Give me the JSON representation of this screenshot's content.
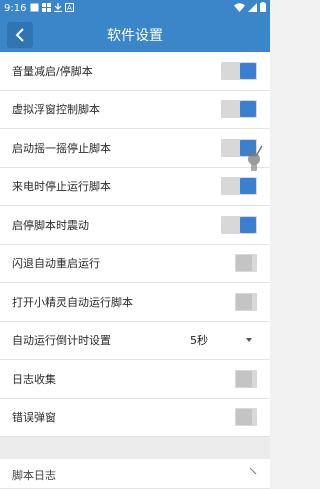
{
  "status": {
    "time": "9:16"
  },
  "appbar": {
    "title": "软件设置"
  },
  "settings": [
    {
      "label": "音量减启/停脚本",
      "type": "toggle",
      "on": true
    },
    {
      "label": "虚拟浮窗控制脚本",
      "type": "toggle",
      "on": true
    },
    {
      "label": "启动摇一摇停止脚本",
      "type": "toggle",
      "on": true
    },
    {
      "label": "来电时停止运行脚本",
      "type": "toggle",
      "on": true
    },
    {
      "label": "启停脚本时震动",
      "type": "toggle",
      "on": true
    },
    {
      "label": "闪退自动重启运行",
      "type": "toggle",
      "on": false
    },
    {
      "label": "打开小精灵自动运行脚本",
      "type": "toggle",
      "on": false
    },
    {
      "label": "自动运行倒计时设置",
      "type": "select",
      "value": "5秒"
    },
    {
      "label": "日志收集",
      "type": "toggle",
      "on": false
    },
    {
      "label": "错误弹窗",
      "type": "toggle",
      "on": false
    }
  ],
  "footer_item": {
    "label": "脚本日志"
  },
  "colors": {
    "primary": "#3a86c8",
    "toggle_on": "#3a7fd0",
    "toggle_off": "#c4c4c4"
  }
}
